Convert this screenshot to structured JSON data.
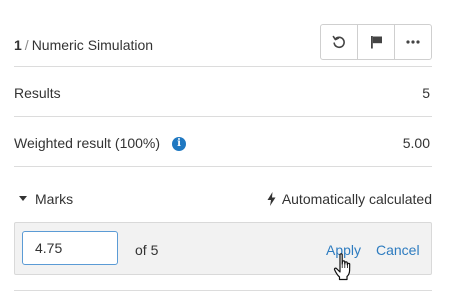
{
  "question": {
    "number": "1",
    "separator": "/",
    "name": "Numeric Simulation"
  },
  "toolbar": {
    "icons": [
      "undo-icon",
      "flag-icon",
      "more-options-icon"
    ]
  },
  "results": {
    "label": "Results",
    "value": "5"
  },
  "weighted": {
    "label": "Weighted result (100%)",
    "info_icon": "i",
    "value": "5.00"
  },
  "marks": {
    "label": "Marks",
    "auto_label": "Automatically calculated",
    "input_value": "4.75",
    "of_text": "of 5",
    "apply_label": "Apply",
    "cancel_label": "Cancel"
  },
  "colors": {
    "link": "#2e7cc0",
    "info": "#1f78c1"
  }
}
